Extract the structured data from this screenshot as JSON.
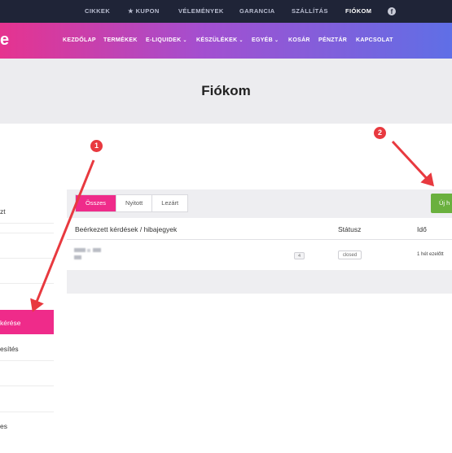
{
  "topbar": {
    "items": [
      "CIKKEK",
      "★ KUPON",
      "VÉLEMÉNYEK",
      "GARANCIA",
      "SZÁLLÍTÁS",
      "FIÓKOM"
    ],
    "active": "FIÓKOM",
    "social_icon": "facebook-icon"
  },
  "nav": {
    "logo_fragment": "e",
    "items": [
      "KEZDŐLAP",
      "TERMÉKEK",
      "E-LIQUIDEK",
      "KÉSZÜLÉKEK",
      "EGYÉB",
      "KOSÁR",
      "PÉNZTÁR",
      "KAPCSOLAT"
    ]
  },
  "page": {
    "title": "Fiókom"
  },
  "sidebar": {
    "items": [
      "zt",
      "",
      "",
      "",
      "kérése",
      "esítés",
      "",
      "",
      "es"
    ],
    "active": "kérése"
  },
  "tickets": {
    "tabs": [
      "Összes",
      "Nyitott",
      "Lezárt"
    ],
    "active_tab": "Összes",
    "new_button_label": "Új h",
    "headers": [
      "Beérkezett kérdések / hibajegyek",
      "Státusz",
      "Idő"
    ],
    "rows": [
      {
        "count": "4",
        "status": "closed",
        "time": "1 hét ezelőtt"
      }
    ]
  },
  "annotations": {
    "markers": [
      "1",
      "2"
    ]
  },
  "colors": {
    "accent": "#ef2b8a",
    "topbar": "#1f2437",
    "button_green": "#6ab03e",
    "annotation_red": "#e8393f"
  }
}
